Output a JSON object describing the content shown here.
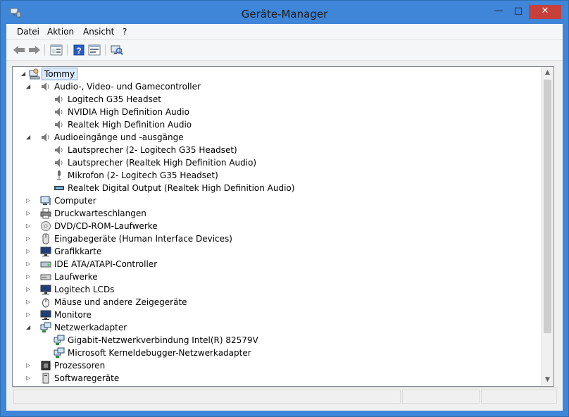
{
  "window": {
    "title": "Geräte-Manager",
    "controls": {
      "minimize": "—",
      "maximize": "□",
      "close": "✕"
    }
  },
  "menu": [
    "Datei",
    "Aktion",
    "Ansicht",
    "?"
  ],
  "toolbar": [
    "back-arrow-icon",
    "forward-arrow-icon",
    "properties-icon",
    "help-icon",
    "console-tree-icon",
    "scan-hardware-icon"
  ],
  "tree": {
    "root": "Tommy",
    "nodes": [
      {
        "label": "Audio-, Video- und Gamecontroller",
        "expanded": true,
        "icon": "speaker-icon"
      },
      {
        "label": "Logitech G35 Headset",
        "child": true,
        "icon": "speaker-icon"
      },
      {
        "label": "NVIDIA High Definition Audio",
        "child": true,
        "icon": "speaker-icon"
      },
      {
        "label": "Realtek High Definition Audio",
        "child": true,
        "icon": "speaker-icon"
      },
      {
        "label": "Audioeingänge und -ausgänge",
        "expanded": true,
        "icon": "speaker-icon"
      },
      {
        "label": "Lautsprecher (2- Logitech G35 Headset)",
        "child": true,
        "icon": "speaker-icon"
      },
      {
        "label": "Lautsprecher (Realtek High Definition Audio)",
        "child": true,
        "icon": "speaker-icon"
      },
      {
        "label": "Mikrofon (2- Logitech G35 Headset)",
        "child": true,
        "icon": "microphone-icon"
      },
      {
        "label": "Realtek Digital Output (Realtek High Definition Audio)",
        "child": true,
        "icon": "digital-output-icon"
      },
      {
        "label": "Computer",
        "expanded": false,
        "icon": "computer-icon"
      },
      {
        "label": "Druckwarteschlangen",
        "expanded": false,
        "icon": "printer-icon"
      },
      {
        "label": "DVD/CD-ROM-Laufwerke",
        "expanded": false,
        "icon": "dvd-icon"
      },
      {
        "label": "Eingabegeräte (Human Interface Devices)",
        "expanded": false,
        "icon": "hid-icon"
      },
      {
        "label": "Grafikkarte",
        "expanded": false,
        "icon": "monitor-icon"
      },
      {
        "label": "IDE ATA/ATAPI-Controller",
        "expanded": false,
        "icon": "ide-icon"
      },
      {
        "label": "Laufwerke",
        "expanded": false,
        "icon": "drive-icon"
      },
      {
        "label": "Logitech LCDs",
        "expanded": false,
        "icon": "monitor-icon"
      },
      {
        "label": "Mäuse und andere Zeigegeräte",
        "expanded": false,
        "icon": "mouse-icon"
      },
      {
        "label": "Monitore",
        "expanded": false,
        "icon": "monitor-icon"
      },
      {
        "label": "Netzwerkadapter",
        "expanded": true,
        "icon": "network-icon"
      },
      {
        "label": "Gigabit-Netzwerkverbindung Intel(R) 82579V",
        "child": true,
        "icon": "network-icon"
      },
      {
        "label": "Microsoft Kerneldebugger-Netzwerkadapter",
        "child": true,
        "icon": "network-icon"
      },
      {
        "label": "Prozessoren",
        "expanded": false,
        "icon": "processor-icon"
      },
      {
        "label": "Softwaregeräte",
        "expanded": false,
        "icon": "software-device-icon"
      }
    ]
  }
}
